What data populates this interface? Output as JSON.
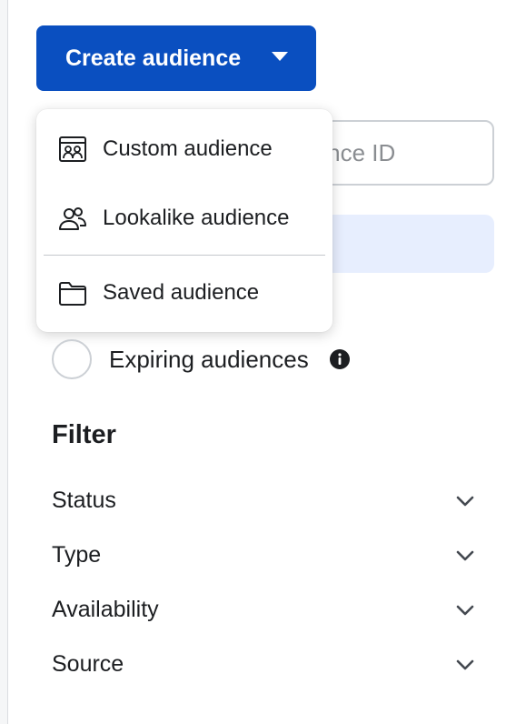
{
  "create_button": {
    "label": "Create audience",
    "caret_icon": "caret-down-icon"
  },
  "search": {
    "visible_text": "udience ID"
  },
  "dropdown": {
    "items": [
      {
        "label": "Custom audience",
        "icon": "custom-audience-icon"
      },
      {
        "label": "Lookalike audience",
        "icon": "people-icon"
      },
      {
        "label": "Saved audience",
        "icon": "folder-icon"
      }
    ]
  },
  "expiring": {
    "label": "Expiring audiences",
    "checked": false,
    "icon": "info-icon"
  },
  "filter": {
    "title": "Filter",
    "rows": [
      {
        "label": "Status",
        "icon": "chevron-down-icon"
      },
      {
        "label": "Type",
        "icon": "chevron-down-icon"
      },
      {
        "label": "Availability",
        "icon": "chevron-down-icon"
      },
      {
        "label": "Source",
        "icon": "chevron-down-icon"
      }
    ]
  },
  "colors": {
    "primary": "#0a4fc0",
    "highlight": "#e7eefe",
    "text": "#1c1e21",
    "muted": "#8a8d91"
  }
}
